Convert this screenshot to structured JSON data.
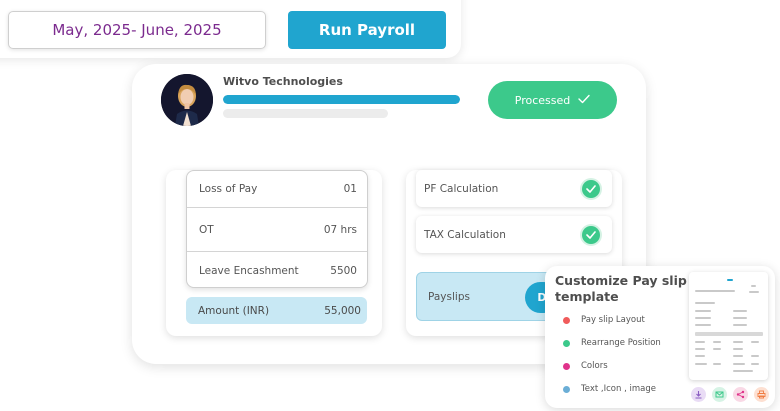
{
  "header": {
    "period": "May, 2025- June, 2025",
    "run_payroll_label": "Run Payroll"
  },
  "company": {
    "name": "Witvo Technologies",
    "progress_fraction": 1.0,
    "status_label": "Processed",
    "status_icon": "check-icon"
  },
  "pay_items": [
    {
      "label": "Loss of Pay",
      "value": "01"
    },
    {
      "label": "OT",
      "value": "07 hrs"
    },
    {
      "label": "Leave Encashment",
      "value": "5500"
    }
  ],
  "amount": {
    "label": "Amount (INR)",
    "value": "55,000"
  },
  "calculations": [
    {
      "label": "PF Calculation",
      "icon": "check-circle-icon"
    },
    {
      "label": "TAX Calculation",
      "icon": "check-circle-icon"
    }
  ],
  "payslips": {
    "label": "Payslips",
    "button_label": "D"
  },
  "customize": {
    "title": "Customize Pay slip template",
    "options": [
      {
        "label": "Pay slip Layout",
        "color": "#f05b5b"
      },
      {
        "label": "Rearrange Position",
        "color": "#3cc98b"
      },
      {
        "label": "Colors",
        "color": "#e0338b"
      },
      {
        "label": "Text ,Icon , image",
        "color": "#6baed6"
      }
    ],
    "actions": [
      {
        "icon": "download-icon",
        "color": "#e9dcf5"
      },
      {
        "icon": "mail-icon",
        "color": "#d6f3e5"
      },
      {
        "icon": "share-icon",
        "color": "#f9d9e6"
      },
      {
        "icon": "print-icon",
        "color": "#fde0d2"
      }
    ]
  },
  "colors": {
    "accent": "#20a5cf",
    "success": "#3cc98b",
    "period_text": "#7b2a8e",
    "light_blue": "#c8e8f4"
  }
}
